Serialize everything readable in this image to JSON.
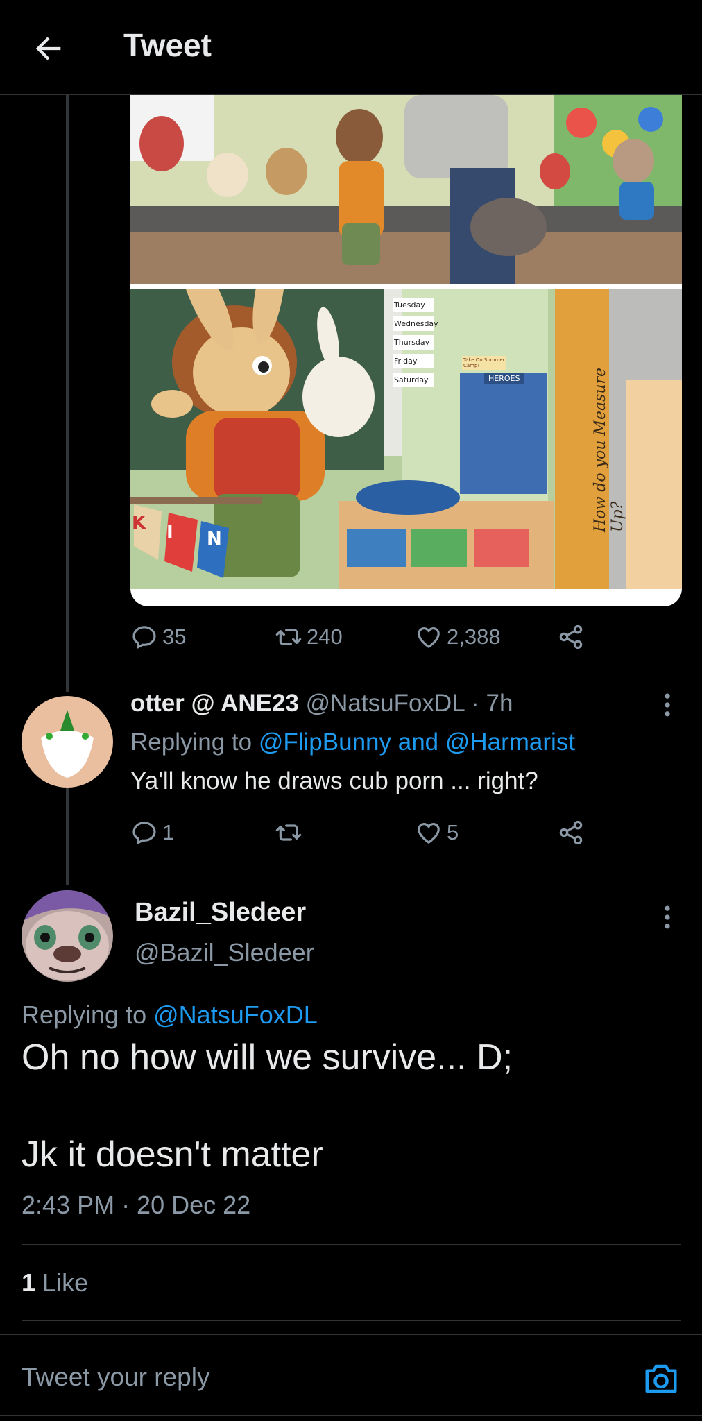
{
  "header": {
    "title": "Tweet"
  },
  "media_card": {
    "schedule_days": [
      "Tuesday",
      "Wednesday",
      "Thursday",
      "Friday",
      "Saturday"
    ],
    "board_heading": "HEROES",
    "ruler_text": "How do you Measure Up?",
    "banner_letters": [
      "K",
      "I",
      "N"
    ],
    "small_sign": "Take On Summer Camp!",
    "stats": {
      "replies": "35",
      "retweets": "240",
      "likes": "2,388"
    }
  },
  "reply_tweet": {
    "display_name": "otter @ ANE23",
    "handle": "@NatsuFoxDL",
    "time": "· 7h",
    "replying_prefix": "Replying to",
    "replying_links": "@FlipBunny and @Harmarist",
    "text": "Ya'll know he draws cub porn ... right?",
    "stats": {
      "replies": "1",
      "retweets": "",
      "likes": "5"
    }
  },
  "main_tweet": {
    "display_name": "Bazil_Sledeer",
    "handle": "@Bazil_Sledeer",
    "replying_prefix": "Replying to",
    "replying_link": "@NatsuFoxDL",
    "line1": "Oh no how will we survive... D;",
    "line2": "Jk it doesn't matter",
    "timestamp": "2:43 PM · 20 Dec 22",
    "like_count": "1",
    "like_label": "Like"
  },
  "composer": {
    "placeholder": "Tweet your reply"
  },
  "colors": {
    "background": "#000000",
    "text": "#e7e9ea",
    "secondary": "#8b98a5",
    "link": "#1d9bf0",
    "divider": "#2f3336"
  }
}
